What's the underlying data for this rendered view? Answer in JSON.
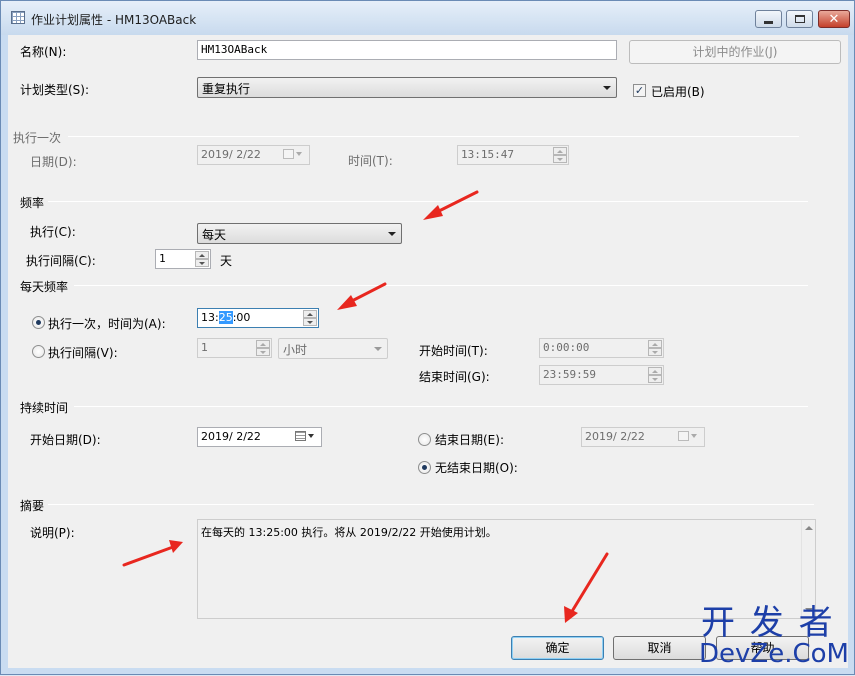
{
  "window": {
    "title": "作业计划属性 - HM13OABack"
  },
  "form": {
    "name_label": "名称(N):",
    "name_value": "HM13OABack",
    "jobs_button": "计划中的作业(J)",
    "schedule_type_label": "计划类型(S):",
    "schedule_type_value": "重复执行",
    "enabled_label": "已启用(B)",
    "enabled_checked": true
  },
  "once": {
    "section": "执行一次",
    "date_label": "日期(D):",
    "date_value": "2019/ 2/22",
    "time_label": "时间(T):",
    "time_value": "13:15:47"
  },
  "frequency": {
    "section": "频率",
    "occurs_label": "执行(C):",
    "occurs_value": "每天",
    "recurs_label": "执行间隔(C):",
    "recurs_value": "1",
    "recurs_unit": "天"
  },
  "daily": {
    "section": "每天频率",
    "once_label": "执行一次，时间为(A):",
    "once_time_hh": "13:",
    "once_time_mm": "25",
    "once_time_ss": ":00",
    "every_label": "执行间隔(V):",
    "every_value": "1",
    "every_unit": "小时",
    "start_label": "开始时间(T):",
    "start_value": "0:00:00",
    "end_label": "结束时间(G):",
    "end_value": "23:59:59"
  },
  "duration": {
    "section": "持续时间",
    "start_date_label": "开始日期(D):",
    "start_date_value": "2019/ 2/22",
    "end_date_label": "结束日期(E):",
    "end_date_value": "2019/ 2/22",
    "no_end_label": "无结束日期(O):"
  },
  "summary": {
    "section": "摘要",
    "desc_label": "说明(P):",
    "desc_value": "在每天的 13:25:00 执行。将从 2019/2/22 开始使用计划。"
  },
  "buttons": {
    "ok": "确定",
    "cancel": "取消",
    "help": "帮助"
  },
  "watermark": {
    "line1": "开 发 者",
    "line2": "DevZe.CoM"
  },
  "colors": {
    "annotation_arrow": "#e8271f",
    "watermark": "#1d3fa8"
  }
}
